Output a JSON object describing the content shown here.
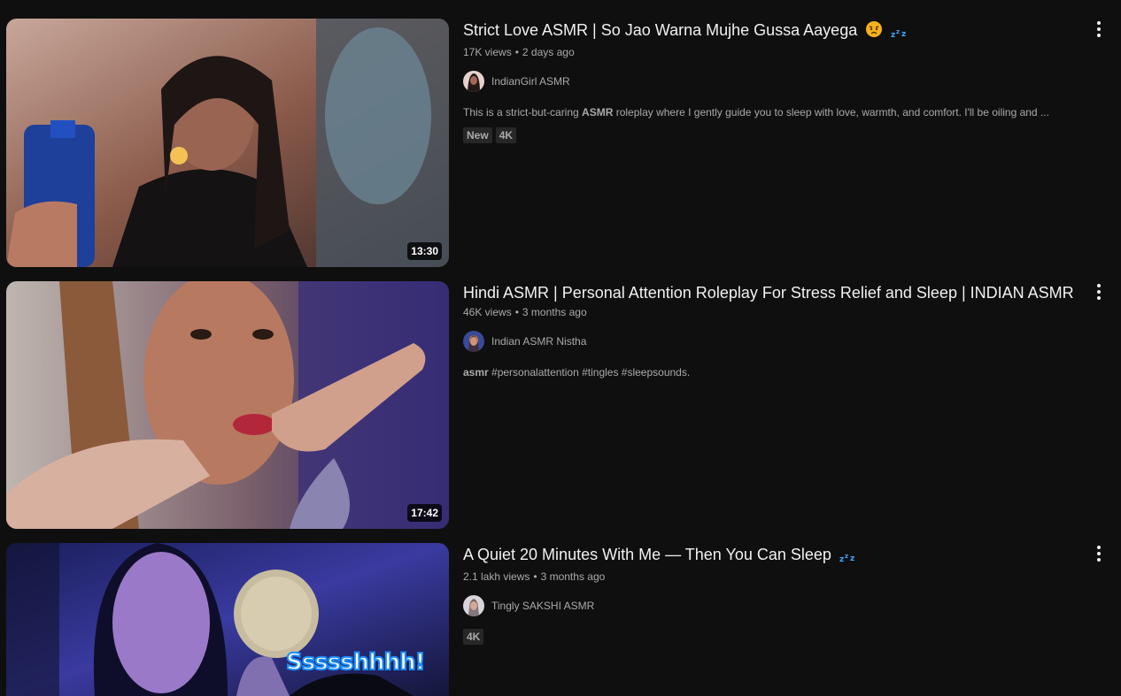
{
  "results": [
    {
      "title": "Strict Love ASMR | So Jao Warna Mujhe Gussa Aayega",
      "views": "17K views",
      "age": "2 days ago",
      "channel": "IndianGirl ASMR",
      "desc_prefix": "This is a strict-but-caring ",
      "desc_bold": "ASMR",
      "desc_suffix": " roleplay where I gently guide you to sleep with love, warmth, and comfort. I'll be oiling and ...",
      "badges": [
        "New",
        "4K"
      ],
      "duration": "13:30",
      "title_emojis": [
        "angry-face-icon",
        "zzz-icon"
      ]
    },
    {
      "title": "Hindi ASMR | Personal Attention Roleplay For Stress Relief and Sleep | INDIAN ASMR",
      "views": "46K views",
      "age": "3 months ago",
      "channel": "Indian ASMR Nistha",
      "desc_bold": "asmr",
      "desc_suffix": " #personalattention #tingles #sleepsounds.",
      "duration": "17:42"
    },
    {
      "title": "A Quiet 20 Minutes With Me — Then You Can Sleep",
      "views": "2.1 lakh views",
      "age": "3 months ago",
      "channel": "Tingly SAKSHI ASMR",
      "badges": [
        "4K"
      ],
      "thumb_caption": "Ssssshhhh!",
      "title_emojis": [
        "zzz-icon"
      ]
    }
  ],
  "colors": {
    "background": "#0f0f0f",
    "text": "#f1f1f1",
    "secondary": "#aaaaaa",
    "badge_bg": "#272727",
    "zzz": "#3ea6ff"
  }
}
